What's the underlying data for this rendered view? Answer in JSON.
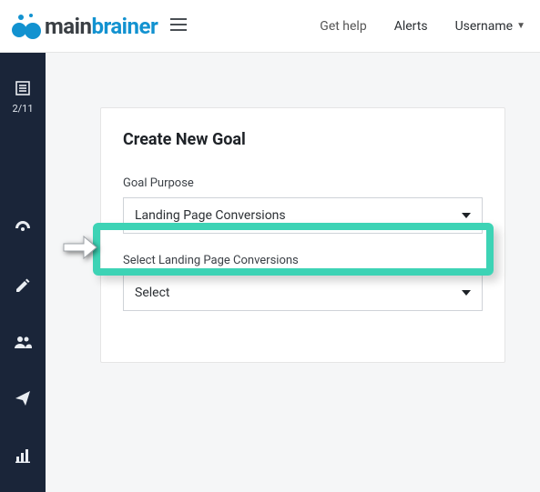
{
  "header": {
    "logo_main": "main",
    "logo_brainer": "brainer",
    "nav": {
      "get_help": "Get help",
      "alerts": "Alerts",
      "username": "Username"
    }
  },
  "sidebar": {
    "progress": "2/11"
  },
  "card": {
    "title": "Create New Goal",
    "goal_purpose_label": "Goal Purpose",
    "goal_purpose_value": "Landing Page Conversions",
    "select_lp_label": "Select Landing Page Conversions",
    "select_lp_value": "Select"
  }
}
